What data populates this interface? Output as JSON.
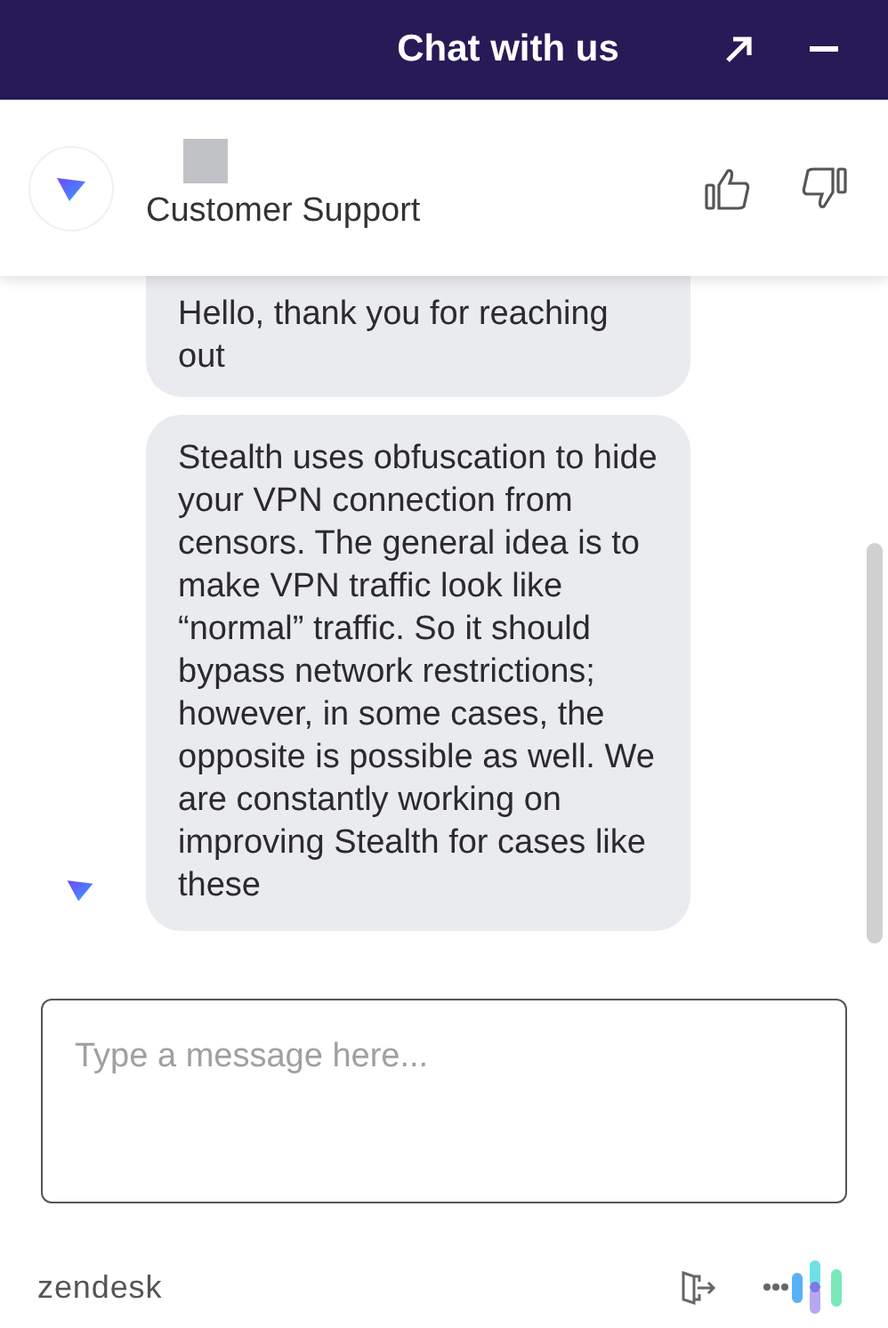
{
  "header": {
    "title": "Chat with us"
  },
  "agent": {
    "role": "Customer Support"
  },
  "messages": [
    {
      "text": "Hello, thank you for reaching out",
      "avatar": false
    },
    {
      "text": "Stealth uses obfuscation to hide your VPN connection from censors. The general idea is to make VPN traffic look like “normal” traffic. So it should bypass network restrictions; however, in some cases, the opposite is possible as well. We are constantly working on improving Stealth for cases like these",
      "avatar": true
    }
  ],
  "composer": {
    "placeholder": "Type a message here..."
  },
  "footer": {
    "brand": "zendesk"
  }
}
